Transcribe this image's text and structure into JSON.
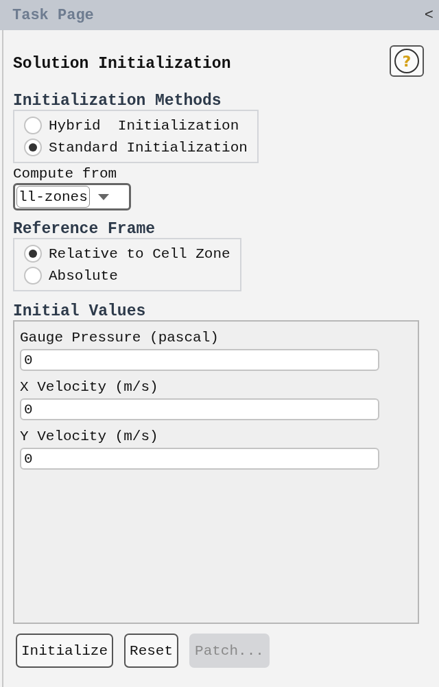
{
  "header": {
    "title": "Task Page",
    "collapse": "<"
  },
  "page": {
    "title": "Solution Initialization",
    "help": "?"
  },
  "methods": {
    "title": "Initialization Methods",
    "options": [
      {
        "label": "Hybrid  Initialization",
        "selected": false
      },
      {
        "label": "Standard Initialization",
        "selected": true
      }
    ]
  },
  "compute_from": {
    "label": "Compute from",
    "value": "ll-zones"
  },
  "reference_frame": {
    "title": "Reference Frame",
    "options": [
      {
        "label": "Relative to Cell Zone",
        "selected": true
      },
      {
        "label": "Absolute",
        "selected": false
      }
    ]
  },
  "initial_values": {
    "title": "Initial Values",
    "fields": [
      {
        "label": "Gauge Pressure (pascal)",
        "value": "0"
      },
      {
        "label": "X Velocity (m/s)",
        "value": "0"
      },
      {
        "label": "Y Velocity (m/s)",
        "value": "0"
      }
    ]
  },
  "buttons": [
    {
      "label": "Initialize",
      "disabled": false
    },
    {
      "label": "Reset",
      "disabled": false
    },
    {
      "label": "Patch...",
      "disabled": true
    }
  ]
}
